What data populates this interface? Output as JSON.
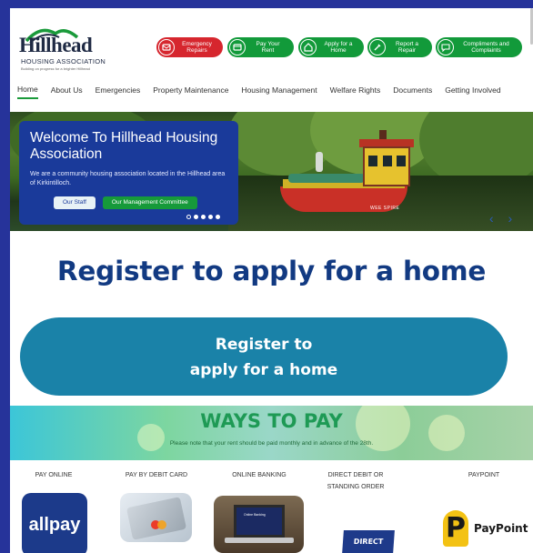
{
  "logo": {
    "name": "Hillhead",
    "subtitle": "HOUSING ASSOCIATION",
    "tagline": "Building on progress for a brighter Hillhead"
  },
  "quick_links": [
    {
      "label": "Emergency Repairs",
      "icon": "wrench-icon",
      "color": "#d6262e"
    },
    {
      "label": "Pay Your Rent",
      "icon": "card-icon",
      "color": "#129a3a"
    },
    {
      "label": "Apply for a Home",
      "icon": "home-icon",
      "color": "#129a3a"
    },
    {
      "label": "Report a Repair",
      "icon": "tools-icon",
      "color": "#129a3a"
    },
    {
      "label": "Compliments and Complaints",
      "icon": "chat-icon",
      "color": "#129a3a"
    }
  ],
  "nav": {
    "items": [
      "Home",
      "About Us",
      "Emergencies",
      "Property Maintenance",
      "Housing Management",
      "Welfare Rights",
      "Documents",
      "Getting Involved"
    ],
    "active": "Home"
  },
  "hero": {
    "title": "Welcome To Hillhead Housing Association",
    "text": "We are a community housing association located in the Hillhead area of Kirkintilloch.",
    "button_staff": "Our Staff",
    "button_committee": "Our Management Committee",
    "boat_name": "WEE SPIRE",
    "arrows": "‹ ›"
  },
  "register": {
    "title": "Register to apply for a home",
    "button_line1": "Register to",
    "button_line2": "apply for a home"
  },
  "ways_to_pay": {
    "title": "WAYS TO PAY",
    "note": "Please note that your rent should be paid monthly and in advance of the 28th.",
    "methods": [
      {
        "label": "PAY ONLINE",
        "logo": "allpay"
      },
      {
        "label": "PAY BY DEBIT CARD"
      },
      {
        "label": "ONLINE BANKING",
        "screen_text": "Online Banking"
      },
      {
        "label": "DIRECT DEBIT OR STANDING ORDER",
        "logo": "DIRECT DEBIT"
      },
      {
        "label": "PAYPOINT",
        "logo": "PayPoint"
      }
    ]
  },
  "colors": {
    "frame": "#26339a",
    "brand_blue": "#123a82",
    "brand_green": "#129a3a",
    "emergency_red": "#d6262e",
    "register_button": "#1a82a8"
  }
}
